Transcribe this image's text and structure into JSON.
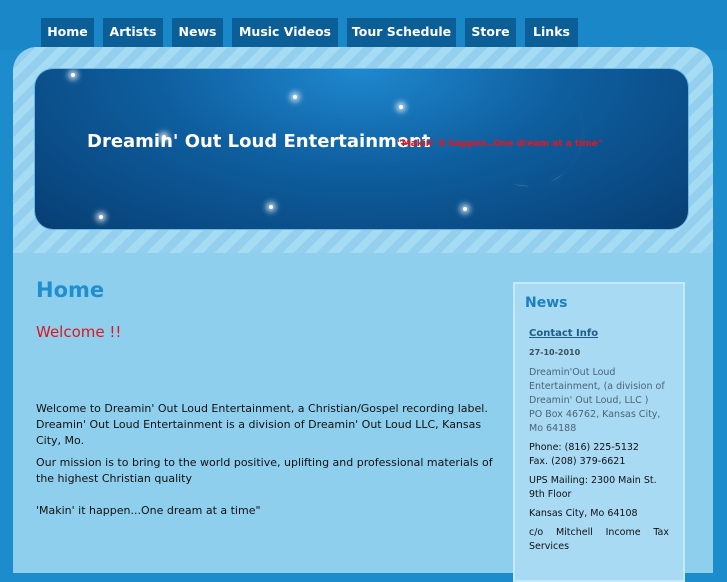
{
  "nav": {
    "items": [
      {
        "label": "Home"
      },
      {
        "label": "Artists"
      },
      {
        "label": "News"
      },
      {
        "label": "Music Videos"
      },
      {
        "label": "Tour Schedule"
      },
      {
        "label": "Store"
      },
      {
        "label": "Links"
      }
    ]
  },
  "banner": {
    "title": "Dreamin' Out Loud Entertainment",
    "slogan": "\"Makin' it happen..One dream at a time\""
  },
  "main": {
    "page_title": "Home",
    "welcome": "Welcome !!",
    "paragraph1": "Welcome to Dreamin' Out Loud Entertainment, a Christian/Gospel recording label.  Dreamin' Out Loud Entertainment is a division of  Dreamin' Out Loud LLC, Kansas City, Mo.",
    "paragraph2": "Our mission is to bring to the world positive, uplifting and professional materials of the highest Christian quality",
    "slogan": "'Makin' it happen...One dream at a time\""
  },
  "sidebar": {
    "title": "News",
    "link": "Contact Info",
    "date": "27-10-2010",
    "line1": "Dreamin'Out Loud Entertainment, (a division of Dreamin' Out Loud, LLC )",
    "line2": "PO Box 46762,  Kansas City, Mo 64188",
    "phone": "Phone: (816) 225-5132",
    "fax": "Fax. (208) 379-6621",
    "ups": "UPS Mailing: 2300 Main St. 9th Floor",
    "city": "Kansas City, Mo 64108",
    "co": "c/o   Mitchell   Income   Tax Services"
  },
  "colors": {
    "background": "#1d8ccd",
    "nav_button": "#0b5f96",
    "content": "#8fcfee",
    "page_title": "#1f8fd0",
    "welcome": "#e0151b"
  }
}
